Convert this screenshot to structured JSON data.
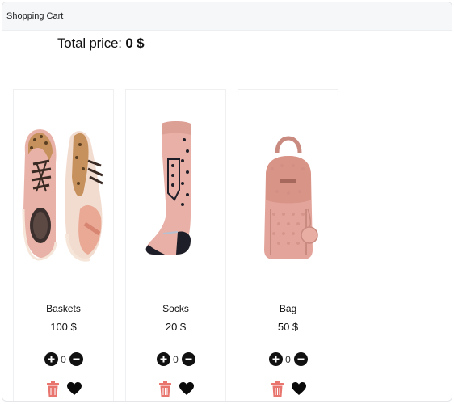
{
  "header": {
    "title": "Shopping Cart"
  },
  "summary": {
    "total_label": "Total price:",
    "total_value": "0 $"
  },
  "products": [
    {
      "name": "Baskets",
      "price": "100 $",
      "quantity": "0",
      "image_icon": "sneakers-image"
    },
    {
      "name": "Socks",
      "price": "20 $",
      "quantity": "0",
      "image_icon": "sock-image"
    },
    {
      "name": "Bag",
      "price": "50 $",
      "quantity": "0",
      "image_icon": "backpack-image"
    }
  ],
  "colors": {
    "header_bg": "#f5f7f9",
    "delete_icon": "#e8766f",
    "button_bg": "#111111",
    "product_pink": "#e7aca4"
  }
}
